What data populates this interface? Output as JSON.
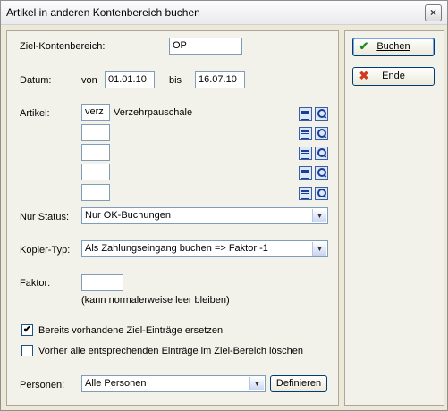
{
  "window": {
    "title": "Artikel in anderen Kontenbereich buchen",
    "close_glyph": "×"
  },
  "form": {
    "ziel_label": "Ziel-Kontenbereich:",
    "ziel_value": "OP",
    "datum_label": "Datum:",
    "von_label": "von",
    "von_value": "01.01.10",
    "bis_label": "bis",
    "bis_value": "16.07.10",
    "artikel_label": "Artikel:",
    "artikel_rows": [
      {
        "code": "verz",
        "name": "Verzehrpauschale"
      },
      {
        "code": "",
        "name": ""
      },
      {
        "code": "",
        "name": ""
      },
      {
        "code": "",
        "name": ""
      },
      {
        "code": "",
        "name": ""
      }
    ],
    "status_label": "Nur Status:",
    "status_value": "Nur OK-Buchungen",
    "kopier_label": "Kopier-Typ:",
    "kopier_value": "Als Zahlungseingang buchen => Faktor -1",
    "faktor_label": "Faktor:",
    "faktor_value": "",
    "faktor_hint": "(kann normalerweise leer bleiben)",
    "checkbox1_label": "Bereits vorhandene Ziel-Einträge ersetzen",
    "checkbox1_checked": true,
    "checkbox1_mark": "✔",
    "checkbox2_label": "Vorher alle entsprechenden Einträge im Ziel-Bereich löschen",
    "checkbox2_checked": false,
    "personen_label": "Personen:",
    "personen_value": "Alle Personen",
    "definieren_label": "Definieren"
  },
  "side": {
    "buchen_label": "Buchen",
    "buchen_icon": "✔",
    "ende_label": "Ende",
    "ende_icon": "✖"
  },
  "colors": {
    "accent": "#003c74",
    "check_green": "#1f8a1f",
    "ende_red": "#d23a1e"
  }
}
